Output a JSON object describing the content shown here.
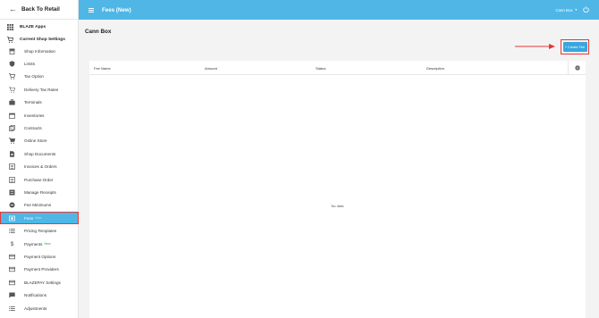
{
  "sidebar": {
    "back_label": "Back To Retail",
    "apps_label": "BLAZE Apps",
    "settings_label": "Current Shop Settings",
    "items": [
      {
        "label": "Shop Information",
        "icon": "storefront-icon"
      },
      {
        "label": "Limits",
        "icon": "shield-icon"
      },
      {
        "label": "Tax Option",
        "icon": "cart-icon"
      },
      {
        "label": "Delivery Tax Rates",
        "icon": "cart-discount-icon"
      },
      {
        "label": "Terminals",
        "icon": "briefcase-icon"
      },
      {
        "label": "Inventories",
        "icon": "calendar-icon"
      },
      {
        "label": "Contracts",
        "icon": "copy-icon"
      },
      {
        "label": "Online Store",
        "icon": "cart-icon"
      },
      {
        "label": "Shop Documents",
        "icon": "document-icon"
      },
      {
        "label": "Invoices & Orders",
        "icon": "invoice-icon"
      },
      {
        "label": "Purchase Order",
        "icon": "invoice-icon"
      },
      {
        "label": "Manage Receipts",
        "icon": "receipt-icon"
      },
      {
        "label": "Fee Minimums",
        "icon": "coin-icon"
      },
      {
        "label": "Fees",
        "badge": "New",
        "icon": "fees-icon",
        "active": true
      },
      {
        "label": "Pricing Templates",
        "icon": "list-icon"
      },
      {
        "label": "Payments",
        "badge": "New",
        "icon": "dollar-icon"
      },
      {
        "label": "Payment Options",
        "icon": "credit-card-icon"
      },
      {
        "label": "Payment Providers",
        "icon": "credit-card-icon"
      },
      {
        "label": "BLAZEPAY Settings",
        "icon": "credit-card-icon"
      },
      {
        "label": "Notifications",
        "icon": "chat-icon"
      },
      {
        "label": "Adjustments",
        "icon": "list-icon"
      }
    ]
  },
  "header": {
    "title": "Fees (New)",
    "shop_name": "Cann Box"
  },
  "main": {
    "page_title": "Cann Box",
    "create_button": "+ Create Fee",
    "table": {
      "columns": [
        "Fee Name",
        "Amount",
        "Status",
        "Description"
      ],
      "empty_text": "No data"
    }
  },
  "colors": {
    "accent": "#4fb6e6",
    "button": "#3aa6de",
    "highlight": "#e53935"
  }
}
